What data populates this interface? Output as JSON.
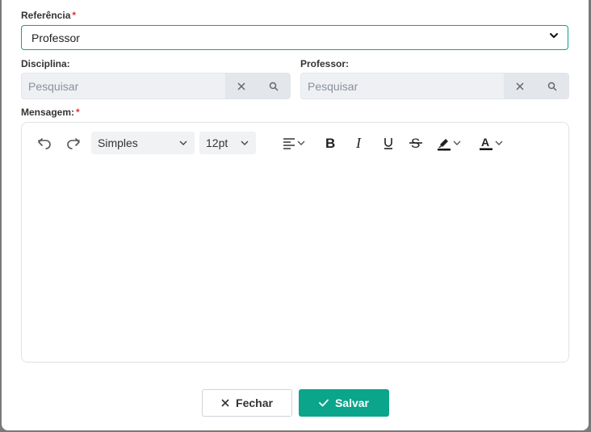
{
  "form": {
    "referencia": {
      "label": "Referência",
      "required_mark": "*",
      "value": "Professor"
    },
    "disciplina": {
      "label": "Disciplina:",
      "placeholder": "Pesquisar"
    },
    "professor": {
      "label": "Professor:",
      "placeholder": "Pesquisar"
    },
    "mensagem": {
      "label": "Mensagem:",
      "required_mark": "*"
    }
  },
  "editor": {
    "font_family": "Simples",
    "font_size": "12pt",
    "content": ""
  },
  "footer": {
    "close_label": "Fechar",
    "save_label": "Salvar"
  },
  "colors": {
    "accent": "#0aa58a",
    "required": "#dd3333",
    "input_bg": "#eef0f4"
  }
}
